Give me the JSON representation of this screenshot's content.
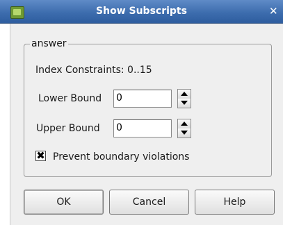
{
  "window": {
    "title": "Show Subscripts",
    "close_glyph": "✕"
  },
  "group": {
    "legend": "answer",
    "index_constraints": "Index Constraints: 0..15"
  },
  "lower_bound": {
    "label": "Lower Bound",
    "value": "0"
  },
  "upper_bound": {
    "label": "Upper Bound",
    "value": "0"
  },
  "prevent_boundary": {
    "label": "Prevent boundary violations",
    "checked": true,
    "mark": "✖"
  },
  "buttons": {
    "ok": "OK",
    "cancel": "Cancel",
    "help": "Help"
  }
}
